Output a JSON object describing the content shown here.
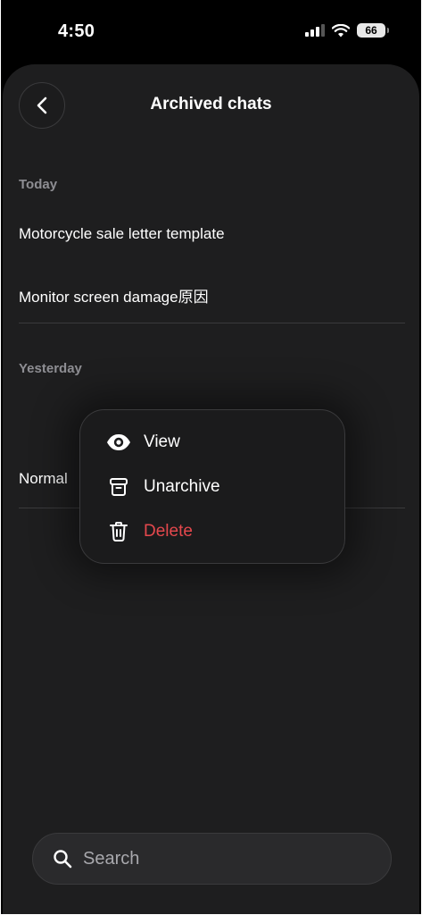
{
  "status_bar": {
    "time": "4:50",
    "battery": "66"
  },
  "header": {
    "title": "Archived chats"
  },
  "sections": [
    {
      "label": "Today",
      "chats": [
        "Motorcycle sale letter template",
        "Monitor screen damage原因"
      ]
    },
    {
      "label": "Yesterday",
      "chats": [
        "Normal"
      ]
    }
  ],
  "context_menu": {
    "items": [
      {
        "label": "View",
        "icon": "eye-icon"
      },
      {
        "label": "Unarchive",
        "icon": "archive-box-icon"
      },
      {
        "label": "Delete",
        "icon": "trash-icon",
        "color": "#e5484d"
      }
    ]
  },
  "search": {
    "placeholder": "Search"
  },
  "colors": {
    "background": "#1e1e1f",
    "danger": "#e5484d",
    "muted": "#8e8e93"
  }
}
